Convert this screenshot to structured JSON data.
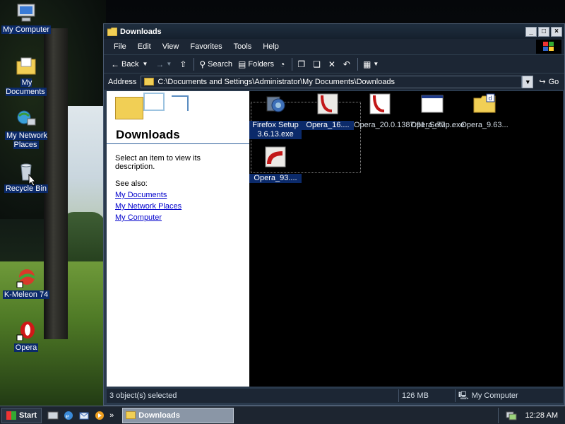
{
  "desktop": {
    "icons": [
      {
        "label": "My Computer"
      },
      {
        "label": "My Documents"
      },
      {
        "label": "My Network Places"
      },
      {
        "label": "Recycle Bin"
      },
      {
        "label": "K-Meleon 74"
      },
      {
        "label": "Opera"
      }
    ]
  },
  "window": {
    "title": "Downloads",
    "controls": {
      "minimize": "_",
      "maximize": "□",
      "close": "×"
    },
    "menu": [
      "File",
      "Edit",
      "View",
      "Favorites",
      "Tools",
      "Help"
    ],
    "toolbar": {
      "back": "Back",
      "search": "Search",
      "folders": "Folders"
    },
    "address": {
      "label": "Address",
      "value": "C:\\Documents and Settings\\Administrator\\My Documents\\Downloads",
      "go": "Go"
    },
    "left_pane": {
      "title": "Downloads",
      "description": "Select an item to view its description.",
      "see_also": "See also:",
      "links": [
        "My Documents",
        "My Network Places",
        "My Computer"
      ]
    },
    "files": [
      {
        "name": "Firefox Setup 3.6.13.exe",
        "selected": true
      },
      {
        "name": "Opera_16....",
        "selected": true
      },
      {
        "name": "Opera_20.0.1387.91_Setup.exe",
        "selected": false
      },
      {
        "name": "Opera_77....",
        "selected": false
      },
      {
        "name": "Opera_9.63...",
        "selected": false
      },
      {
        "name": "Opera_93....",
        "selected": true
      }
    ],
    "status": {
      "selection": "3 object(s) selected",
      "size": "126 MB",
      "location": "My Computer"
    }
  },
  "taskbar": {
    "start": "Start",
    "task": "Downloads",
    "clock": "12:28 AM"
  },
  "colors": {
    "selection": "#0b2a6a",
    "window_chrome": "#1c2634",
    "link": "#0000cc"
  }
}
